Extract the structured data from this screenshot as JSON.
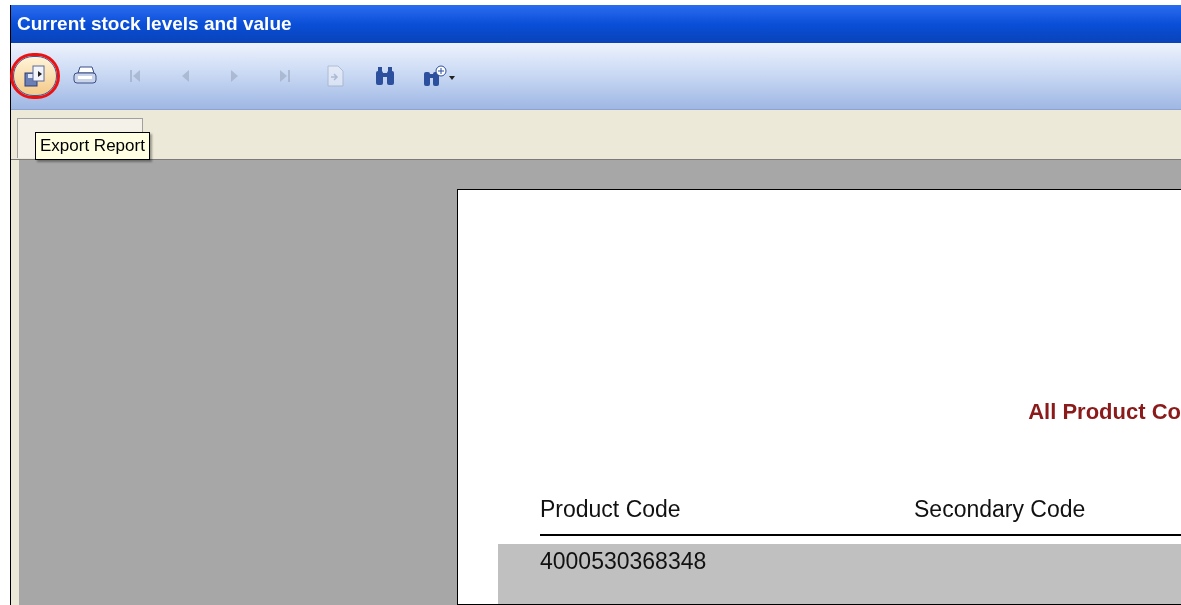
{
  "window": {
    "title": "Current stock levels and value"
  },
  "toolbar": [
    {
      "kind": "export",
      "disabled": false,
      "highlighted": true
    },
    {
      "kind": "print",
      "disabled": false,
      "highlighted": false
    },
    {
      "kind": "first",
      "disabled": true,
      "highlighted": false
    },
    {
      "kind": "prev",
      "disabled": true,
      "highlighted": false
    },
    {
      "kind": "next",
      "disabled": true,
      "highlighted": false
    },
    {
      "kind": "last",
      "disabled": true,
      "highlighted": false
    },
    {
      "kind": "goto",
      "disabled": true,
      "highlighted": false
    },
    {
      "kind": "find",
      "disabled": false,
      "highlighted": false
    },
    {
      "kind": "zoom",
      "disabled": false,
      "highlighted": false
    }
  ],
  "tooltip": "Export Report",
  "report": {
    "title": "All Product Co",
    "columns": [
      "Product Code",
      "Secondary Code"
    ],
    "rows": [
      [
        "4000530368348"
      ]
    ]
  }
}
